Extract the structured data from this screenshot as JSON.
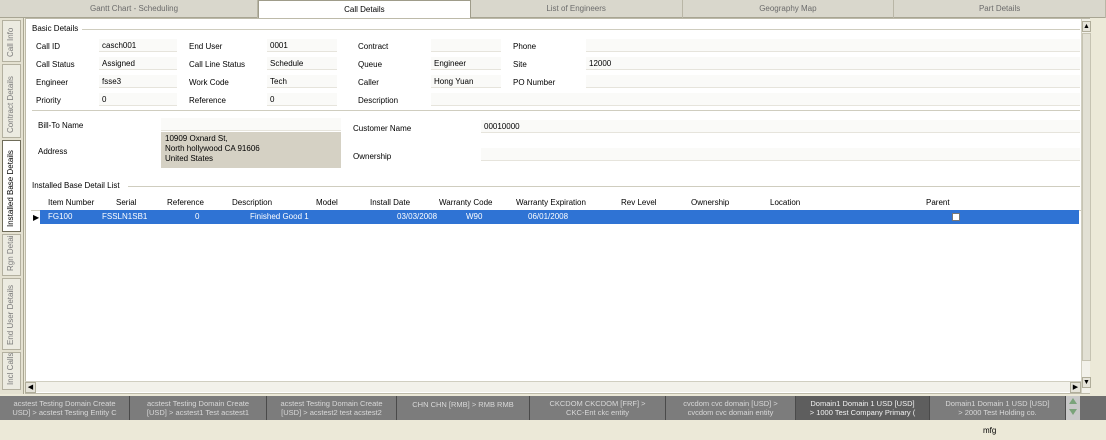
{
  "top_tabs": [
    {
      "label": "Gantt Chart - Scheduling"
    },
    {
      "label": "Call Details"
    },
    {
      "label": "List of Engineers"
    },
    {
      "label": "Geography Map"
    },
    {
      "label": "Part Details"
    }
  ],
  "side_tabs": [
    {
      "label": "Call Info"
    },
    {
      "label": "Contract Details"
    },
    {
      "label": "Installed Base Details"
    },
    {
      "label": "Rgn Details"
    },
    {
      "label": "End User Details"
    },
    {
      "label": "Incl Calls"
    }
  ],
  "basic_details": {
    "title": "Basic Details",
    "call_id_label": "Call ID",
    "call_id": "casch001",
    "end_user_label": "End User",
    "end_user": "0001",
    "contract_label": "Contract",
    "contract": "",
    "phone_label": "Phone",
    "phone": "",
    "call_status_label": "Call Status",
    "call_status": "Assigned",
    "call_line_status_label": "Call Line Status",
    "call_line_status": "Schedule",
    "queue_label": "Queue",
    "queue": "Engineer",
    "site_label": "Site",
    "site": "12000",
    "engineer_label": "Engineer",
    "engineer": "fsse3",
    "work_code_label": "Work Code",
    "work_code": "Tech",
    "caller_label": "Caller",
    "caller": "Hong Yuan",
    "po_number_label": "PO Number",
    "po_number": "",
    "priority_label": "Priority",
    "priority": "0",
    "reference_label": "Reference",
    "reference": "0",
    "description_label": "Description",
    "description": ""
  },
  "bill_to": {
    "bill_to_name_label": "Bill-To Name",
    "bill_to_name": "",
    "address_label": "Address",
    "address_line1": "10909 Oxnard St,",
    "address_line2": "North hollywood  CA  91606",
    "address_line3": "United States",
    "customer_name_label": "Customer Name",
    "customer_name": "00010000",
    "ownership_label": "Ownership",
    "ownership": ""
  },
  "installed_base": {
    "title": "Installed Base Detail List",
    "columns": [
      "Item Number",
      "Serial",
      "Reference",
      "Description",
      "Model",
      "Install Date",
      "Warranty Code",
      "Warranty Expiration",
      "Rev Level",
      "Ownership",
      "Location",
      "Parent"
    ],
    "rows": [
      {
        "item_number": "FG100",
        "serial": "FSSLN1SB1",
        "reference": "0",
        "description": "Finished Good 1",
        "model": "",
        "install_date": "03/03/2008",
        "warranty_code": "W90",
        "warranty_expiration": "06/01/2008",
        "rev_level": "",
        "ownership": "",
        "location": "",
        "parent": false
      }
    ],
    "selected_color": "#2f73d4"
  },
  "domain_tabs": [
    {
      "line1": "acstest Testing Domain Create",
      "line2": "USD] > acstest Testing Entity C"
    },
    {
      "line1": "acstest Testing Domain Create",
      "line2": "[USD] > acstest1 Test acstest1"
    },
    {
      "line1": "acstest Testing Domain Create",
      "line2": "[USD] > acstest2 test acstest2"
    },
    {
      "line1": "CHN CHN [RMB] > RMB RMB",
      "line2": ""
    },
    {
      "line1": "CKCDOM CKCDOM [FRF] >",
      "line2": "CKC-Ent ckc entity"
    },
    {
      "line1": "cvcdom cvc domain [USD] >",
      "line2": "cvcdom cvc domain entity"
    },
    {
      "line1": "Domain1 Domain 1 USD [USD]",
      "line2": "> 1000 Test Company Primary ("
    },
    {
      "line1": "Domain1 Domain 1 USD [USD]",
      "line2": "> 2000 Test Holding co."
    }
  ],
  "status": {
    "user": "mfg"
  }
}
